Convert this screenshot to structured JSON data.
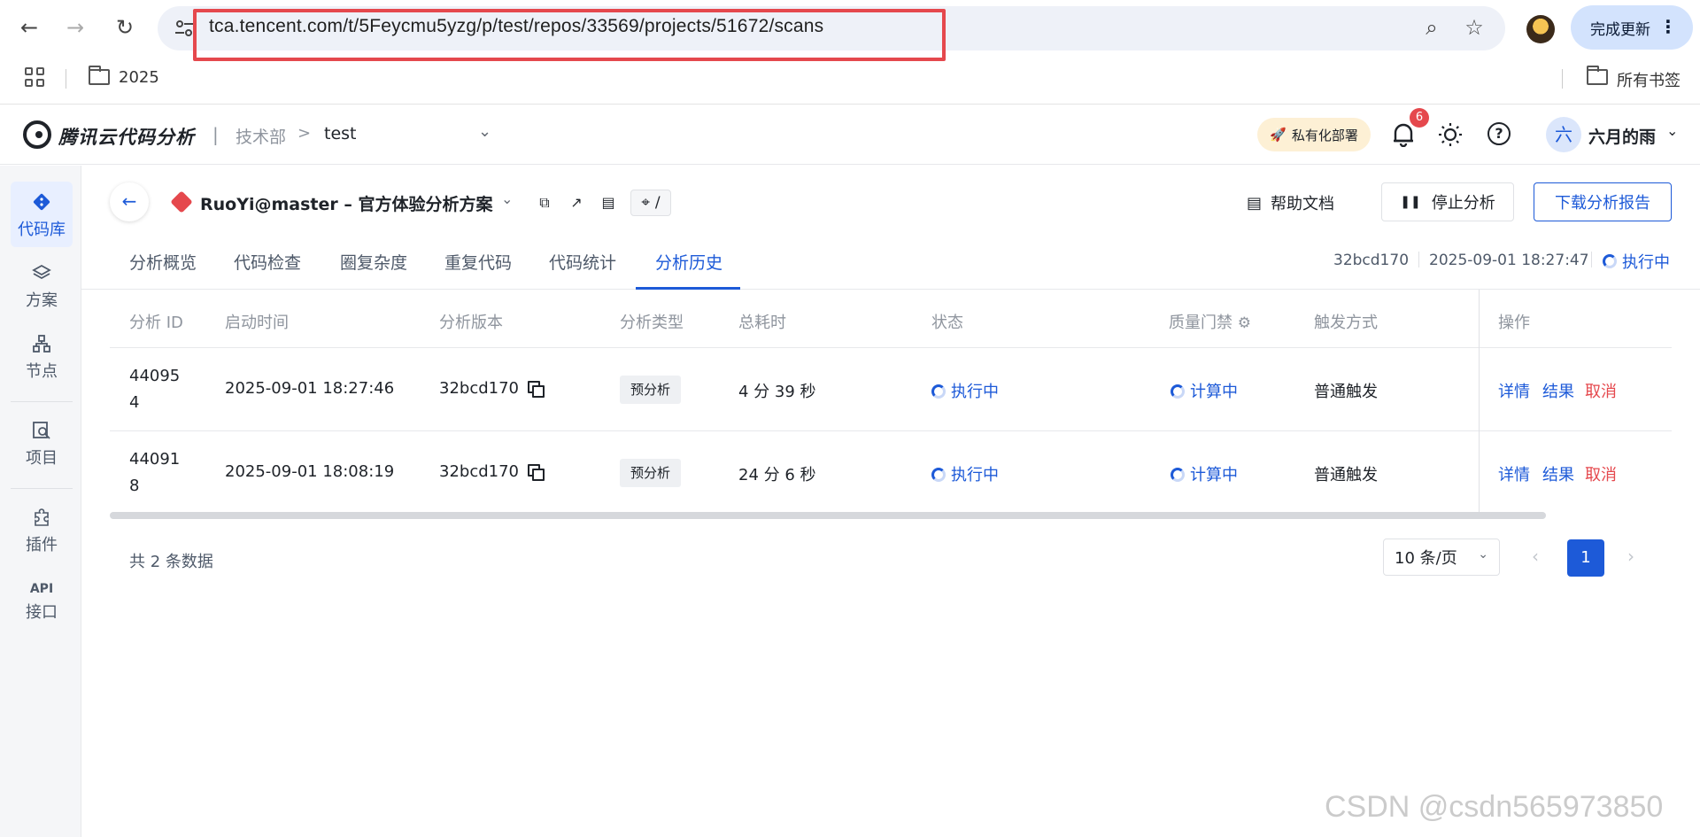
{
  "browser": {
    "url": "tca.tencent.com/t/5Feycmu5yzg/p/test/repos/33569/projects/51672/scans",
    "update_label": "完成更新",
    "bookmark_folder": "2025",
    "all_bookmarks": "所有书签"
  },
  "header": {
    "product": "腾讯云代码分析",
    "divider": "|",
    "dept": "技术部",
    "crumb_arrow": ">",
    "team": "test",
    "deploy_label": "私有化部署",
    "notifications": "6",
    "user_initial": "六",
    "user_name": "六月的雨"
  },
  "sidebar": {
    "items": [
      {
        "label": "代码库"
      },
      {
        "label": "方案"
      },
      {
        "label": "节点"
      },
      {
        "label": "项目"
      },
      {
        "label": "插件"
      },
      {
        "label": "接口",
        "sub": "API"
      }
    ]
  },
  "project": {
    "title": "RuoYi@master – 官方体验分析方案",
    "path": "/",
    "help_doc": "帮助文档",
    "stop_label": "停止分析",
    "download_label": "下载分析报告"
  },
  "tabs": [
    "分析概览",
    "代码检查",
    "圈复杂度",
    "重复代码",
    "代码统计",
    "分析历史"
  ],
  "meta": {
    "version": "32bcd170",
    "time": "2025-09-01 18:27:47",
    "status": "执行中"
  },
  "table": {
    "headers": [
      "分析 ID",
      "启动时间",
      "分析版本",
      "分析类型",
      "总耗时",
      "状态",
      "质量门禁",
      "触发方式",
      "操作"
    ],
    "rows": [
      {
        "id_line1": "44095",
        "id_line2": "4",
        "start": "2025-09-01 18:27:46",
        "version": "32bcd170",
        "type": "预分析",
        "duration": "4 分 39 秒",
        "status": "执行中",
        "gate": "计算中",
        "trigger": "普通触发",
        "op_detail": "详情",
        "op_result": "结果",
        "op_cancel": "取消"
      },
      {
        "id_line1": "44091",
        "id_line2": "8",
        "start": "2025-09-01 18:08:19",
        "version": "32bcd170",
        "type": "预分析",
        "duration": "24 分 6 秒",
        "status": "执行中",
        "gate": "计算中",
        "trigger": "普通触发",
        "op_detail": "详情",
        "op_result": "结果",
        "op_cancel": "取消"
      }
    ]
  },
  "pagination": {
    "total": "共 2 条数据",
    "page_size": "10 条/页",
    "current": "1"
  },
  "watermark": "CSDN @csdn565973850"
}
